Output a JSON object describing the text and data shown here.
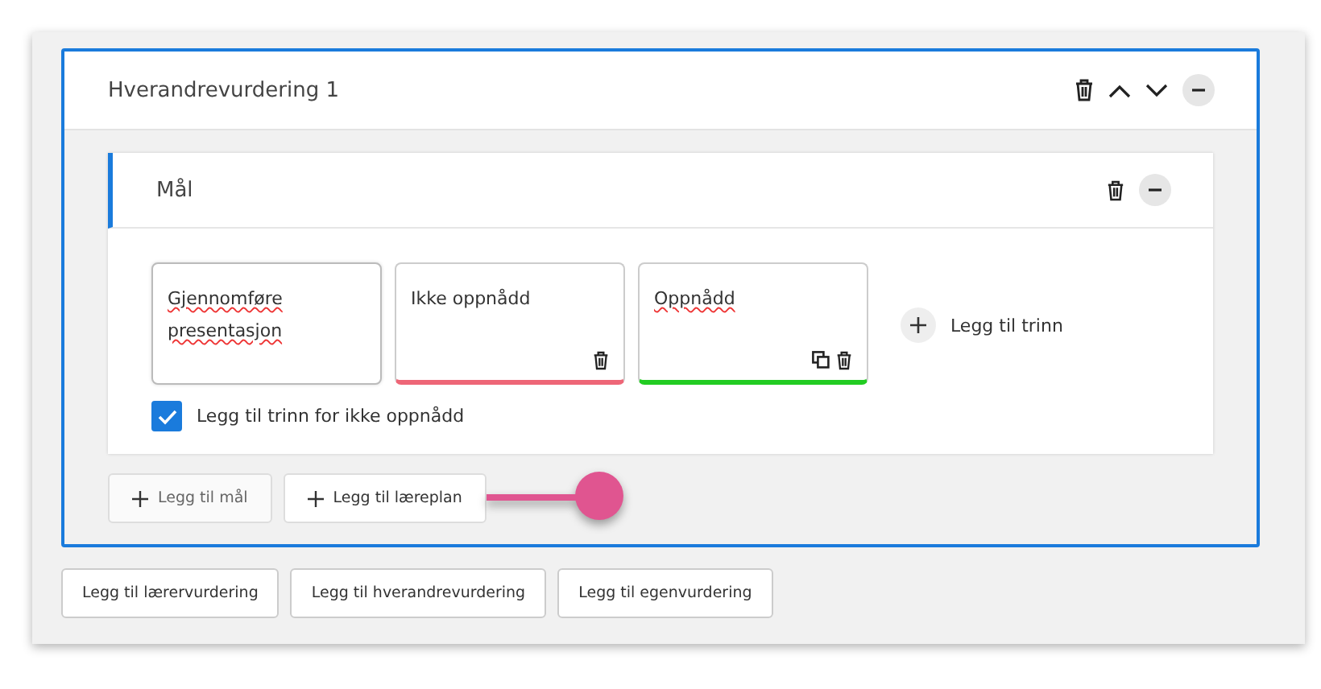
{
  "section": {
    "title": "Hverandrevurdering 1",
    "expanded": true
  },
  "goal": {
    "title": "Mål",
    "expanded": true,
    "steps": [
      {
        "kind": "goal",
        "text": "Gjennomføre presentasjon",
        "misspelled": true,
        "copy": false,
        "delete": false
      },
      {
        "kind": "level",
        "text": "Ikke oppnådd",
        "misspelled": false,
        "color": "#ee6677",
        "copy": false,
        "delete": true
      },
      {
        "kind": "level",
        "text": "Oppnådd",
        "misspelled": true,
        "color": "#22cc22",
        "copy": true,
        "delete": true
      }
    ],
    "add_step": "Legg til trinn",
    "checkbox": {
      "label": "Legg til trinn for ikke oppnådd",
      "checked": true
    }
  },
  "section_buttons": [
    {
      "label": "Legg til mål",
      "highlighted": false
    },
    {
      "label": "Legg til læreplan",
      "highlighted": true
    }
  ],
  "bottom_buttons": [
    "Legg til lærervurdering",
    "Legg til hverandrevurdering",
    "Legg til egenvurdering"
  ]
}
